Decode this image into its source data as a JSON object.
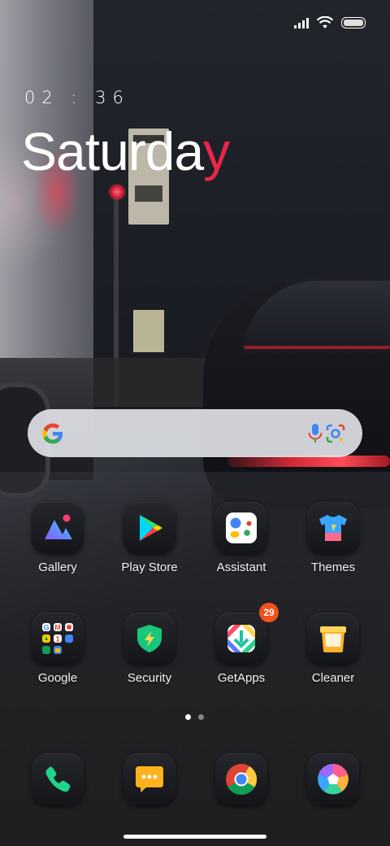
{
  "status_bar": {
    "icons": [
      "signal-icon",
      "wifi-icon",
      "battery-icon"
    ]
  },
  "clock": {
    "time": "02 : 36",
    "day_main": "Saturda",
    "day_accent": "y",
    "accent_color": "#e8264a"
  },
  "search": {
    "icons": [
      "google-g-icon",
      "mic-icon",
      "lens-icon"
    ]
  },
  "apps_row1": [
    {
      "label": "Gallery",
      "icon": "gallery-icon"
    },
    {
      "label": "Play Store",
      "icon": "play-store-icon"
    },
    {
      "label": "Assistant",
      "icon": "assistant-icon"
    },
    {
      "label": "Themes",
      "icon": "themes-icon"
    }
  ],
  "apps_row2": [
    {
      "label": "Google",
      "icon": "google-folder-icon"
    },
    {
      "label": "Security",
      "icon": "security-icon"
    },
    {
      "label": "GetApps",
      "icon": "getapps-icon",
      "badge": "29"
    },
    {
      "label": "Cleaner",
      "icon": "cleaner-icon"
    }
  ],
  "page_indicator": {
    "pages": 2,
    "current": 1
  },
  "dock": [
    {
      "icon": "phone-icon"
    },
    {
      "icon": "messages-icon"
    },
    {
      "icon": "chrome-icon"
    },
    {
      "icon": "camera-icon"
    }
  ],
  "colors": {
    "badge": "#f2511b",
    "accent": "#e8264a"
  }
}
